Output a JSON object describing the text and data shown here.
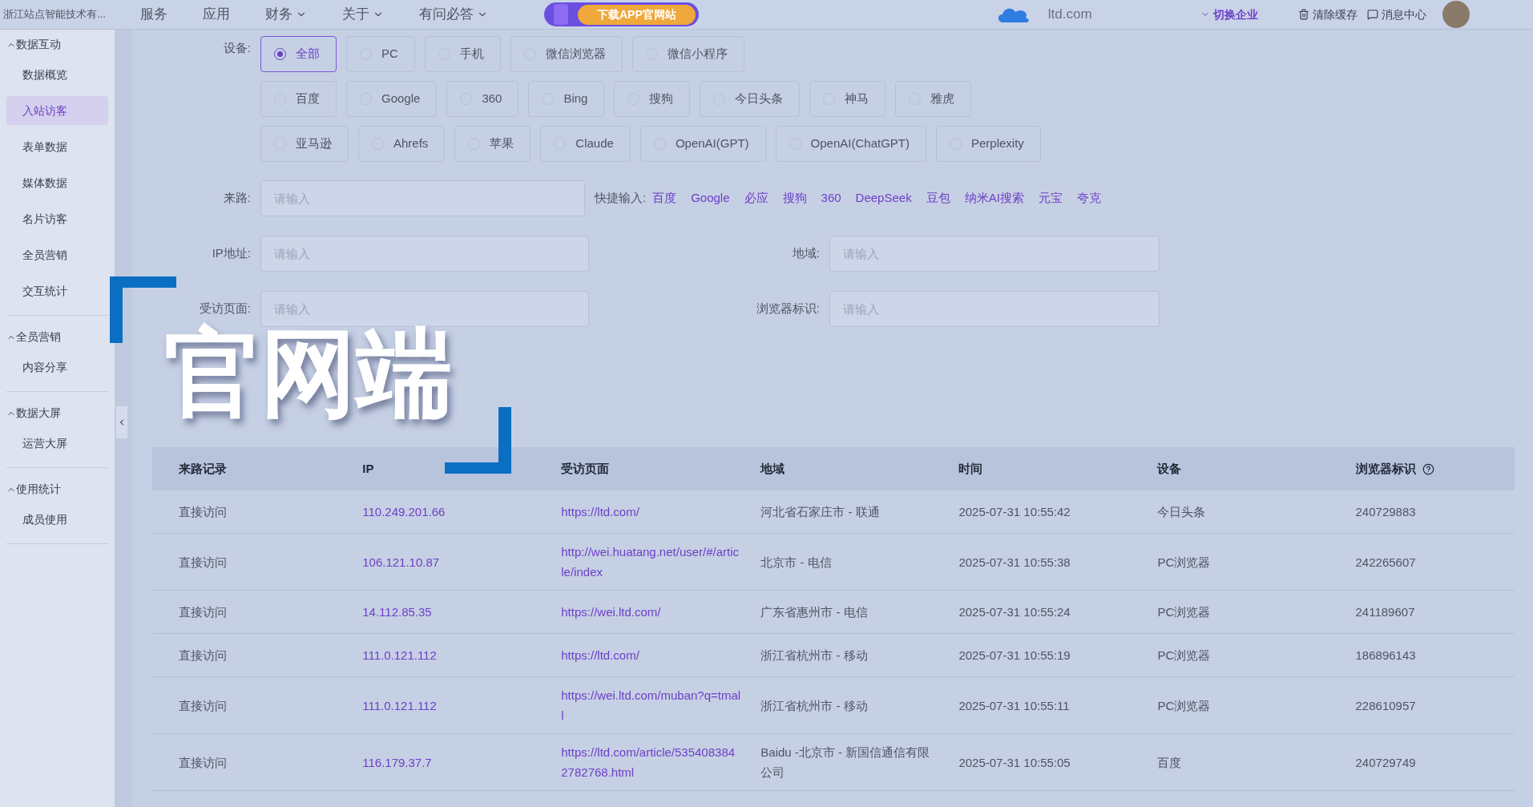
{
  "topbar": {
    "company": "浙江站点智能技术有...",
    "nav": [
      {
        "label": "服务",
        "dropdown": false
      },
      {
        "label": "应用",
        "dropdown": false
      },
      {
        "label": "财务",
        "dropdown": true
      },
      {
        "label": "关于",
        "dropdown": true
      },
      {
        "label": "有问必答",
        "dropdown": true
      }
    ],
    "promo": "下载APP官网站",
    "domain": "ltd.com",
    "switch": "切换企业",
    "actions": [
      {
        "kind": "trash",
        "label": "清除缓存"
      },
      {
        "kind": "message",
        "label": "消息中心"
      }
    ]
  },
  "sidebar": {
    "sections": [
      {
        "title": "数据互动",
        "expanded": true,
        "children": [
          {
            "label": "数据概览",
            "selected": false
          },
          {
            "label": "入站访客",
            "selected": true
          },
          {
            "label": "表单数据",
            "selected": false
          },
          {
            "label": "媒体数据",
            "selected": false
          },
          {
            "label": "名片访客",
            "selected": false
          },
          {
            "label": "全员营销",
            "selected": false
          },
          {
            "label": "交互统计",
            "selected": false
          }
        ]
      },
      {
        "title": "全员营销",
        "expanded": true,
        "children": [
          {
            "label": "内容分享",
            "selected": false
          }
        ]
      },
      {
        "title": "数据大屏",
        "expanded": true,
        "children": [
          {
            "label": "运营大屏",
            "selected": false
          }
        ]
      },
      {
        "title": "使用统计",
        "expanded": true,
        "children": [
          {
            "label": "成员使用",
            "selected": false
          }
        ]
      }
    ]
  },
  "filters": {
    "device_label": "设备:",
    "option_rows": [
      [
        {
          "label": "全部",
          "selected": true
        },
        {
          "label": "PC",
          "selected": false
        },
        {
          "label": "手机",
          "selected": false
        },
        {
          "label": "微信浏览器",
          "selected": false
        },
        {
          "label": "微信小程序",
          "selected": false
        }
      ],
      [
        {
          "label": "百度",
          "selected": false
        },
        {
          "label": "Google",
          "selected": false
        },
        {
          "label": "360",
          "selected": false
        },
        {
          "label": "Bing",
          "selected": false
        },
        {
          "label": "搜狗",
          "selected": false
        },
        {
          "label": "今日头条",
          "selected": false
        },
        {
          "label": "神马",
          "selected": false
        },
        {
          "label": "雅虎",
          "selected": false
        }
      ],
      [
        {
          "label": "亚马逊",
          "selected": false
        },
        {
          "label": "Ahrefs",
          "selected": false
        },
        {
          "label": "苹果",
          "selected": false
        },
        {
          "label": "Claude",
          "selected": false
        },
        {
          "label": "OpenAI(GPT)",
          "selected": false
        },
        {
          "label": "OpenAI(ChatGPT)",
          "selected": false
        },
        {
          "label": "Perplexity",
          "selected": false
        }
      ]
    ],
    "source": {
      "label": "来路:",
      "placeholder": "请输入"
    },
    "quick_label": "快捷输入:",
    "quick_links": [
      "百度",
      "Google",
      "必应",
      "搜狗",
      "360",
      "DeepSeek",
      "豆包",
      "纳米AI搜索",
      "元宝",
      "夸克"
    ],
    "ip": {
      "label": "IP地址:",
      "placeholder": "请输入"
    },
    "region": {
      "label": "地域:",
      "placeholder": "请输入"
    },
    "page": {
      "label": "受访页面:",
      "placeholder": "请输入"
    },
    "browser": {
      "label": "浏览器标识:",
      "placeholder": "请输入"
    }
  },
  "overlay_title": "官网端",
  "table": {
    "columns": [
      "来路记录",
      "IP",
      "受访页面",
      "地域",
      "时间",
      "设备",
      "浏览器标识"
    ],
    "rows": [
      {
        "source": "直接访问",
        "ip": "110.249.201.66",
        "page": "https://ltd.com/",
        "region": "河北省石家庄市 - 联通",
        "time": "2025-07-31 10:55:42",
        "device": "今日头条",
        "browser_id": "240729883"
      },
      {
        "source": "直接访问",
        "ip": "106.121.10.87",
        "page": "http://wei.huatang.net/user/#/article/index",
        "region": "北京市 - 电信",
        "time": "2025-07-31 10:55:38",
        "device": "PC浏览器",
        "browser_id": "242265607"
      },
      {
        "source": "直接访问",
        "ip": "14.112.85.35",
        "page": "https://wei.ltd.com/",
        "region": "广东省惠州市 - 电信",
        "time": "2025-07-31 10:55:24",
        "device": "PC浏览器",
        "browser_id": "241189607"
      },
      {
        "source": "直接访问",
        "ip": "111.0.121.112",
        "page": "https://ltd.com/",
        "region": "浙江省杭州市 - 移动",
        "time": "2025-07-31 10:55:19",
        "device": "PC浏览器",
        "browser_id": "186896143"
      },
      {
        "source": "直接访问",
        "ip": "111.0.121.112",
        "page": "https://wei.ltd.com/muban?q=tmall",
        "region": "浙江省杭州市 - 移动",
        "time": "2025-07-31 10:55:11",
        "device": "PC浏览器",
        "browser_id": "228610957"
      },
      {
        "source": "直接访问",
        "ip": "116.179.37.7",
        "page": "https://ltd.com/article/5354083842782768.html",
        "region": "Baidu -北京市 - 新国信通信有限公司",
        "time": "2025-07-31 10:55:05",
        "device": "百度",
        "browser_id": "240729749"
      }
    ]
  }
}
